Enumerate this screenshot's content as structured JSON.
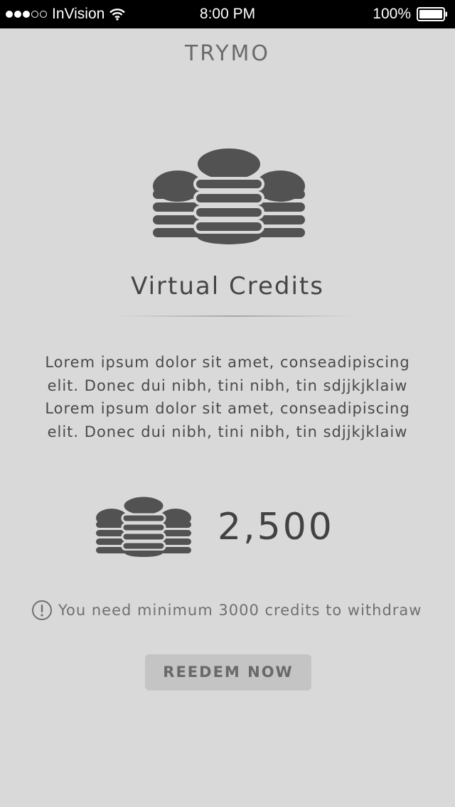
{
  "status_bar": {
    "carrier": "InVision",
    "time": "8:00 PM",
    "battery": "100%",
    "signal_icon": "signal-dots-icon",
    "wifi_icon": "wifi-icon",
    "battery_icon": "battery-icon"
  },
  "header": {
    "title": "TRYMO"
  },
  "hero": {
    "icon": "coins-stack-icon",
    "title": "Virtual Credits"
  },
  "description": {
    "lines": [
      "Lorem ipsum dolor sit amet, conseadipiscing",
      "elit. Donec dui nibh, tini nibh, tin sdjjkjklaiw",
      "Lorem ipsum dolor sit amet, conseadipiscing",
      "elit. Donec dui nibh, tini nibh, tin sdjjkjklaiw"
    ]
  },
  "balance": {
    "icon": "coins-stack-icon",
    "value": "2,500"
  },
  "notice": {
    "icon": "alert-circle-icon",
    "text": "You need minimum 3000 credits to withdraw"
  },
  "actions": {
    "redeem_label": "REEDEM NOW"
  },
  "colors": {
    "background": "#d9d9d9",
    "status_bar": "#000000",
    "icon": "#525252",
    "button": "#c4c4c4",
    "button_text": "#696969"
  }
}
